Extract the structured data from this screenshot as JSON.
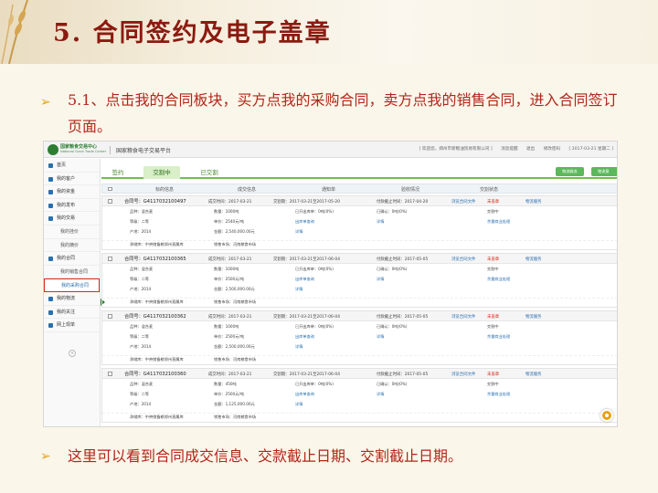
{
  "slide": {
    "title": "5. 合同签约及电子盖章",
    "bullet1": "5.1、点击我的合同板块，买方点我的采购合同，卖方点我的销售合同，进入合同签订页面。",
    "bullet2": "这里可以看到合同成交信息、交款截止日期、交割截止日期。",
    "bullet_glyph": "➢"
  },
  "app": {
    "logo_name": "国家粮食交易中心",
    "logo_sub": "National Grain Trade Center",
    "site_name": "国家粮食电子交易平台",
    "welcome": "[ 欢迎您，郑州市新粮油贸易有限公司 ]",
    "messages": "消息提醒",
    "logout": "退出",
    "change_password": "修改密码",
    "date": "[ 2017-03-21 星期二 ]"
  },
  "sidebar": {
    "items": [
      {
        "label": "首页",
        "sub": false,
        "active": false
      },
      {
        "label": "我的客户",
        "sub": false,
        "active": false
      },
      {
        "label": "我的资金",
        "sub": false,
        "active": false
      },
      {
        "label": "我的发布",
        "sub": false,
        "active": false
      },
      {
        "label": "我的交易",
        "sub": false,
        "active": false
      },
      {
        "label": "我的挂价",
        "sub": true,
        "active": false
      },
      {
        "label": "我的摘价",
        "sub": true,
        "active": false
      },
      {
        "label": "我的合同",
        "sub": false,
        "active": false
      },
      {
        "label": "我的销售合同",
        "sub": true,
        "active": false
      },
      {
        "label": "我的采购合同",
        "sub": true,
        "active": true
      },
      {
        "label": "我的物流",
        "sub": false,
        "active": false
      },
      {
        "label": "我的关注",
        "sub": false,
        "active": false
      },
      {
        "label": "网上现单",
        "sub": false,
        "active": false
      }
    ],
    "collapse": "«"
  },
  "tabs": [
    {
      "label": "签约",
      "active": false
    },
    {
      "label": "交割中",
      "active": true
    },
    {
      "label": "已交割",
      "active": false
    }
  ],
  "buttons": {
    "logistics_service": "物流服务",
    "logistics_intent": "物流意向"
  },
  "columns": [
    "标的信息",
    "成交信息",
    "通知单",
    "验收情况",
    "交割状态"
  ],
  "orders": [
    {
      "contract_no": "合同号：G4117032100497",
      "deal_time": "成交时间：2017-03-21",
      "delivery_period": "交割期：2017-03-21至2017-05-20",
      "pay_deadline": "付款截止时间：2017-04-20",
      "contract_file": "浏览合同文件",
      "unsealed": "未盖章",
      "logistics": "物流服务",
      "variety": "品种：混合麦",
      "grade": "等级：二等",
      "origin": "产地：2014",
      "qty": "数量：1000吨",
      "price": "单价：2540元/吨",
      "amount": "金额：2,540,000.00元",
      "out_note": "已开出库单：0吨(0%)",
      "out_link": "出库单查询",
      "detail": "详情",
      "recv": "已确认：0吨(0%)",
      "recv_detail": "详情",
      "status": "交割中",
      "status_link": "余量商业处理",
      "depot": "承储库：中央储备粮郑州直属库",
      "market": "销售市场：河南粮食市场"
    },
    {
      "contract_no": "合同号：G4117032100365",
      "deal_time": "成交时间：2017-03-21",
      "delivery_period": "交割期：2017-03-21至2017-06-04",
      "pay_deadline": "付款截止时间：2017-05-05",
      "contract_file": "浏览合同文件",
      "unsealed": "未盖章",
      "logistics": "物流服务",
      "variety": "品种：混合麦",
      "grade": "等级：二等",
      "origin": "产地：2014",
      "qty": "数量：1000吨",
      "price": "单价：2500元/吨",
      "amount": "金额：2,500,000.00元",
      "out_note": "已开出库单：0吨(0%)",
      "out_link": "出库单查询",
      "detail": "详情",
      "recv": "已确认：0吨(0%)",
      "recv_detail": "详情",
      "status": "交割中",
      "status_link": "余量商业处理",
      "depot": "承储库：中央储备粮郑州直属库",
      "market": "销售市场：河南粮食市场"
    },
    {
      "contract_no": "合同号：G4117032100362",
      "deal_time": "成交时间：2017-03-21",
      "delivery_period": "交割期：2017-03-21至2017-06-04",
      "pay_deadline": "付款截止时间：2017-05-05",
      "contract_file": "浏览合同文件",
      "unsealed": "未盖章",
      "logistics": "物流服务",
      "variety": "品种：混合麦",
      "grade": "等级：二等",
      "origin": "产地：2014",
      "qty": "数量：1000吨",
      "price": "单价：2500元/吨",
      "amount": "金额：2,500,000.00元",
      "out_note": "已开出库单：0吨(0%)",
      "out_link": "出库单查询",
      "detail": "详情",
      "recv": "已确认：0吨(0%)",
      "recv_detail": "详情",
      "status": "交割中",
      "status_link": "余量商业处理",
      "depot": "承储库：中央储备粮郑州直属库",
      "market": "销售市场：河南粮食市场"
    },
    {
      "contract_no": "合同号：G4117032100360",
      "deal_time": "成交时间：2017-03-21",
      "delivery_period": "交割期：2017-03-21至2017-06-04",
      "pay_deadline": "付款截止时间：2017-05-05",
      "contract_file": "浏览合同文件",
      "unsealed": "未盖章",
      "logistics": "物流服务",
      "variety": "品种：混合麦",
      "grade": "等级：二等",
      "origin": "产地：2014",
      "qty": "数量：450吨",
      "price": "单价：2500元/吨",
      "amount": "金额：1,125,000.00元",
      "out_note": "已开出库单：0吨(0%)",
      "out_link": "出库单查询",
      "detail": "详情",
      "recv": "已确认：0吨(0%)",
      "recv_detail": "详情",
      "status": "交割中",
      "status_link": "余量商业处理",
      "depot": "承储库：中央储备粮郑州直属库",
      "market": "销售市场：河南粮食市场"
    }
  ]
}
